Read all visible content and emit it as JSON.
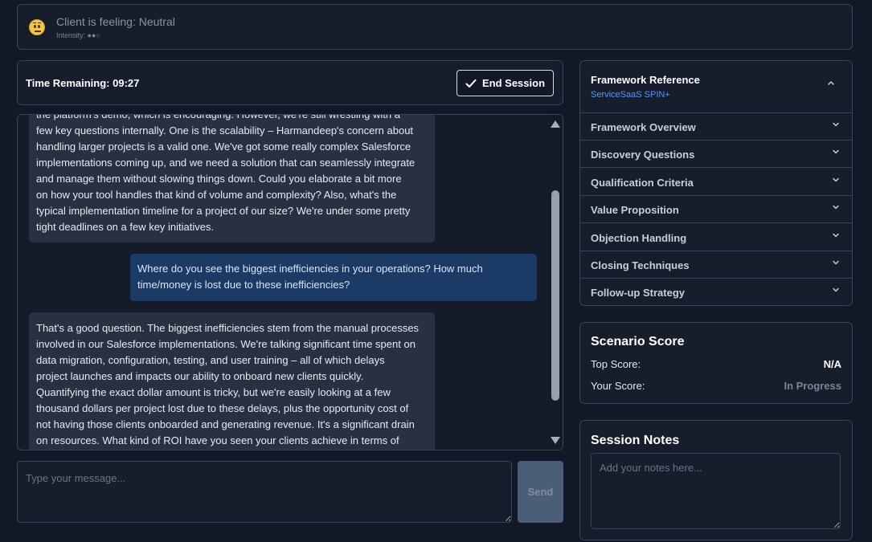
{
  "mood": {
    "title": "Client is feeling: Neutral",
    "intensity": "Intensity: ●●○",
    "icon": "neutral-face-icon"
  },
  "timer": {
    "label": "Time Remaining: 09:27"
  },
  "end_session": {
    "label": "End Session",
    "icon": "check-icon"
  },
  "chat": {
    "messages": [
      {
        "role": "client",
        "lines": [
          "the platform's demo, which is encouraging. However, we're still wrestling with a",
          "few key questions internally. One is the scalability – Harmandeep's concern about",
          "handling larger projects is a valid one. We've got some really complex Salesforce",
          "implementations coming up, and we need a solution that can seamlessly integrate",
          "and manage them without slowing things down. Could you elaborate a bit more",
          "on how your tool handles that kind of volume and complexity? Also, what's the",
          "typical implementation timeline for a project of our size? We're under some pretty",
          "tight deadlines on a few key initiatives."
        ]
      },
      {
        "role": "user",
        "lines": [
          "Where do you see the biggest inefficiencies in your operations? How much",
          "time/money is lost due to these inefficiencies?"
        ]
      },
      {
        "role": "client",
        "lines": [
          "That's a good question. The biggest inefficiencies stem from the manual processes",
          "involved in our Salesforce implementations. We're talking significant time spent on",
          "data migration, configuration, testing, and user training – all of which delays",
          "project launches and impacts our ability to onboard new clients quickly.",
          "Quantifying the exact dollar amount is tricky, but we're easily looking at a few",
          "thousand dollars per project lost due to these delays, plus the opportunity cost of",
          "not having those clients onboarded and generating revenue. It's a significant drain",
          "on resources. What kind of ROI have you seen your clients achieve in terms of"
        ]
      }
    ]
  },
  "composer": {
    "placeholder": "Type your message...",
    "send_label": "Send"
  },
  "framework": {
    "title": "Framework Reference",
    "subtitle": "ServiceSaaS SPIN+",
    "items": [
      {
        "label": "Framework Overview"
      },
      {
        "label": "Discovery Questions"
      },
      {
        "label": "Qualification Criteria"
      },
      {
        "label": "Value Proposition"
      },
      {
        "label": "Objection Handling"
      },
      {
        "label": "Closing Techniques"
      },
      {
        "label": "Follow-up Strategy"
      }
    ]
  },
  "score": {
    "title": "Scenario Score",
    "top_label": "Top Score:",
    "top_value": "N/A",
    "your_label": "Your Score:",
    "your_value": "In Progress"
  },
  "notes": {
    "title": "Session Notes",
    "placeholder": "Add your notes here..."
  },
  "colors": {
    "background": "#121826",
    "panel": "#161d2b",
    "border": "#3a4355",
    "client_bubble": "#283142",
    "user_bubble": "#1c3a66",
    "accent_link": "#4f9bff",
    "send_disabled": "#4b5e78"
  }
}
